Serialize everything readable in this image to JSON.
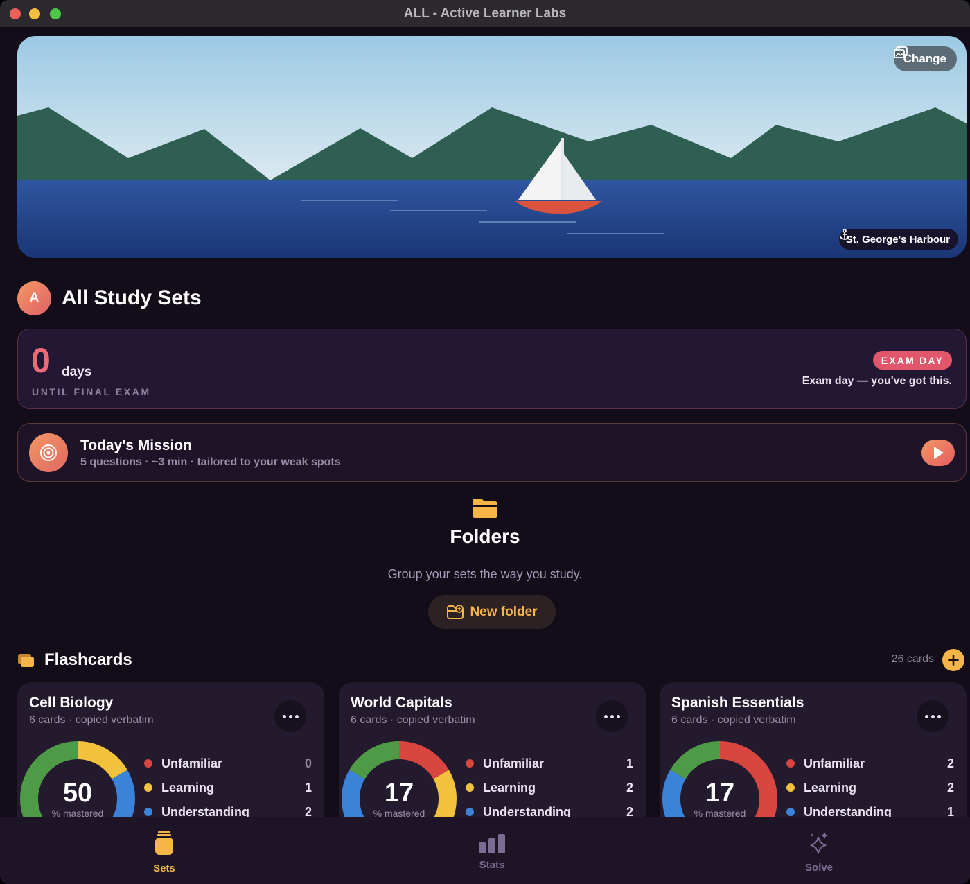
{
  "window": {
    "title": "ALL - Active Learner Labs"
  },
  "hero": {
    "change_label": "Change",
    "location": "St. George's Harbour"
  },
  "header": {
    "avatar_letter": "A",
    "title": "All Study Sets"
  },
  "exam": {
    "days": "0",
    "days_unit": "days",
    "until_label": "UNTIL FINAL EXAM",
    "badge": "EXAM DAY",
    "message": "Exam day — you've got this."
  },
  "mission": {
    "title": "Today's Mission",
    "subtitle": "5 questions · ~3 min · tailored to your weak spots"
  },
  "folders": {
    "title": "Folders",
    "subtitle": "Group your sets the way you study.",
    "new_folder_label": "New folder"
  },
  "flashcards": {
    "title": "Flashcards",
    "count": "26 cards",
    "sets": [
      {
        "name": "Cell Biology",
        "meta": "6 cards · copied verbatim",
        "mastered": "50",
        "mastered_label": "% mastered",
        "legend": [
          {
            "label": "Unfamiliar",
            "value": "0"
          },
          {
            "label": "Learning",
            "value": "1"
          },
          {
            "label": "Understanding",
            "value": "2"
          }
        ]
      },
      {
        "name": "World Capitals",
        "meta": "6 cards · copied verbatim",
        "mastered": "17",
        "mastered_label": "% mastered",
        "legend": [
          {
            "label": "Unfamiliar",
            "value": "1"
          },
          {
            "label": "Learning",
            "value": "2"
          },
          {
            "label": "Understanding",
            "value": "2"
          }
        ]
      },
      {
        "name": "Spanish Essentials",
        "meta": "6 cards · copied verbatim",
        "mastered": "17",
        "mastered_label": "% mastered",
        "legend": [
          {
            "label": "Unfamiliar",
            "value": "2"
          },
          {
            "label": "Learning",
            "value": "2"
          },
          {
            "label": "Understanding",
            "value": "1"
          }
        ]
      }
    ]
  },
  "colors": {
    "accent": "#f5b547",
    "unfamiliar": "#d9453f",
    "learning": "#f2c23c",
    "understanding": "#3b82d9",
    "mastered": "#4f9a46"
  },
  "tabs": [
    {
      "label": "Sets",
      "icon": "jar-icon",
      "active": true
    },
    {
      "label": "Stats",
      "icon": "bar-chart-icon",
      "active": false
    },
    {
      "label": "Solve",
      "icon": "sparkles-icon",
      "active": false
    }
  ]
}
